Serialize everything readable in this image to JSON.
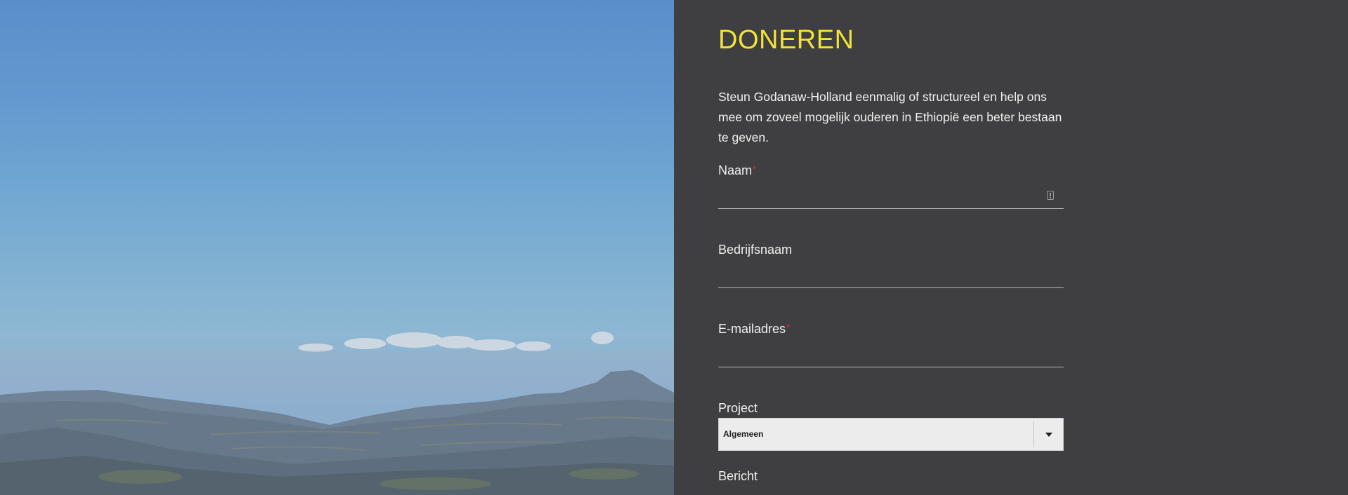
{
  "form": {
    "title": "DONEREN",
    "intro": "Steun Godanaw-Holland eenmalig of structureel en help ons mee om zoveel mogelijk ouderen in Ethiopië een beter bestaan te geven.",
    "required_marker": "*",
    "fields": {
      "naam": {
        "label": "Naam",
        "value": "",
        "required": true
      },
      "bedrijfsnaam": {
        "label": "Bedrijfsnaam",
        "value": "",
        "required": false
      },
      "email": {
        "label": "E-mailadres",
        "value": "",
        "required": true
      },
      "project": {
        "label": "Project",
        "selected": "Algemeen"
      },
      "bericht": {
        "label": "Bericht"
      }
    }
  },
  "colors": {
    "panel_background": "#3f3f41",
    "title": "#f2e23a",
    "text": "#f0f0f0",
    "required_marker": "#d9342b"
  },
  "icons": {
    "naam_field": "autofill-icon",
    "project_select": "caret-down-icon"
  }
}
